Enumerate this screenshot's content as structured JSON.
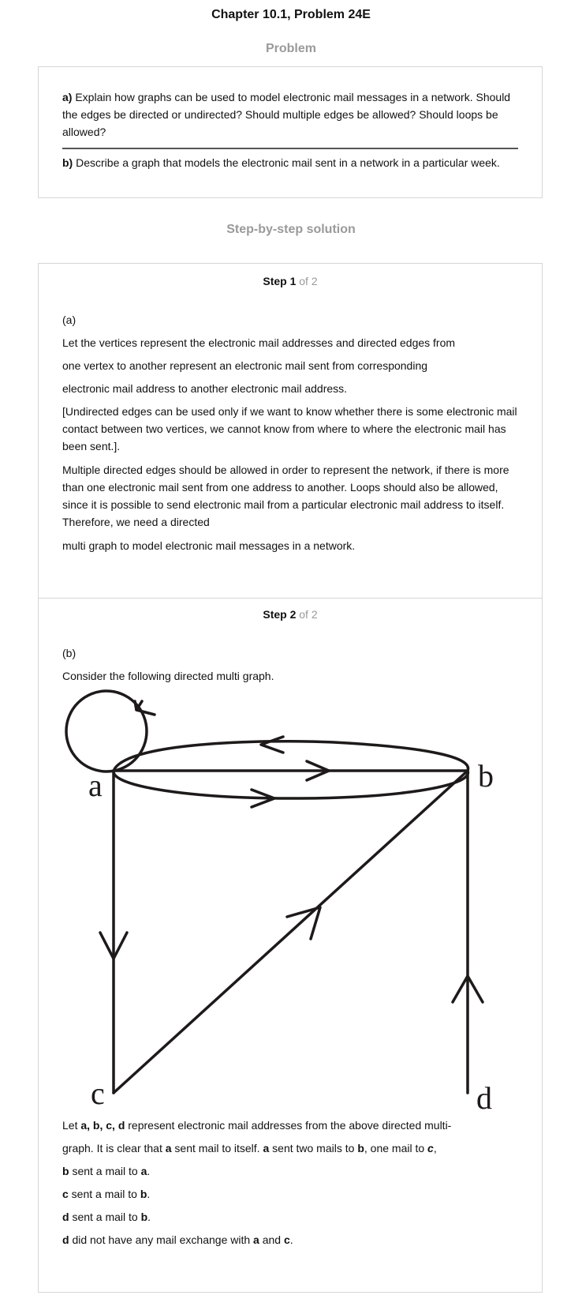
{
  "header": {
    "title": "Chapter 10.1, Problem 24E",
    "problem_heading": "Problem",
    "solution_heading": "Step-by-step solution"
  },
  "problem": {
    "part_a_label": "a)",
    "part_a_text": "Explain how graphs can be used to model electronic mail messages in a network. Should the edges be directed or undirected? Should multiple edges be allowed? Should loops be allowed?",
    "part_b_label": "b)",
    "part_b_text": "Describe a graph that models the electronic mail sent in a network in a particular week."
  },
  "steps": [
    {
      "step_word": "Step 1",
      "of_text": "of 2",
      "part_label": "(a)",
      "line1": "Let the vertices represent the electronic mail addresses and directed edges from",
      "line2": "one vertex to another represent an electronic mail sent from corresponding",
      "line3": "electronic mail address to another electronic mail address.",
      "para_undirected": "[Undirected edges can be used only if we want to know whether there is some electronic mail contact between two vertices, we cannot know from where to where the electronic mail has been sent.].",
      "para_multiple": "Multiple directed edges should be allowed in order to represent the network, if there is more than one electronic mail sent from one address to another. Loops should also be allowed, since it is possible to send electronic mail from a particular electronic mail address to itself. Therefore, we need a directed",
      "last_line": "multi graph to model electronic mail messages in a network."
    },
    {
      "step_word": "Step 2",
      "of_text": "of 2",
      "part_label": "(b)",
      "intro": "Consider the following directed multi graph.",
      "graph_vertices": [
        "a",
        "b",
        "c",
        "d"
      ],
      "explain1": {
        "t1": "Let ",
        "v": "a, b, c, d",
        "t2": " represent electronic mail addresses from the above directed multi-"
      },
      "explain2": {
        "t1": "graph. It is clear that ",
        "a": "a",
        "t2": " sent mail to itself. ",
        "a2": "a",
        "t3": " sent two mails to ",
        "b": "b",
        "t4": ", one mail to ",
        "c": "c",
        "t5": ","
      },
      "explain3": {
        "v1": "b",
        "t1": " sent a mail to ",
        "v2": "a",
        "t2": "."
      },
      "explain4": {
        "v1": "c",
        "t1": " sent a mail to ",
        "v2": "b",
        "t2": "."
      },
      "explain5": {
        "v1": "d",
        "t1": " sent a mail to ",
        "v2": "b",
        "t2": "."
      },
      "explain6": {
        "v1": "d",
        "t1": " did not have any mail exchange with ",
        "v2": "a",
        "t2": " and ",
        "v3": "c",
        "t3": "."
      }
    }
  ],
  "colors": {
    "text": "#111111",
    "muted_heading": "#9a9a9a",
    "border": "#d6d6d6",
    "graph_stroke": "#1e1a1a"
  }
}
